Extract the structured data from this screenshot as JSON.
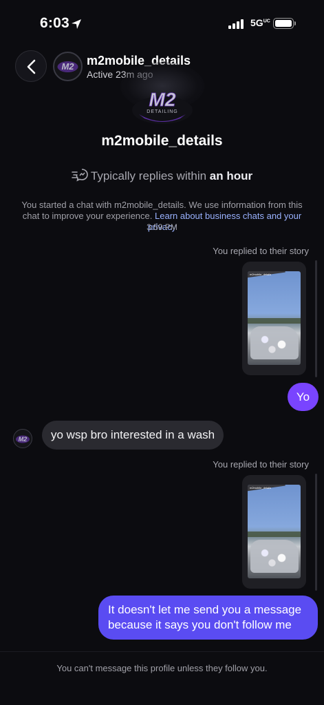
{
  "status_bar": {
    "time": "6:03",
    "network": "5G",
    "network_suffix": "UC"
  },
  "header": {
    "username": "m2mobile_details",
    "activity": "Active 23m ago",
    "icons": [
      "back-chevron-icon",
      "location-arrow-icon",
      "signal-bars-icon",
      "battery-icon"
    ]
  },
  "profile": {
    "name": "m2mobile_details",
    "logo_text_main": "M2",
    "logo_text_sub": "DETAILING",
    "replies_prefix": "Typically replies within ",
    "replies_bold": "an hour",
    "info_text": "You started a chat with m2mobile_details. We use information from this chat to improve your experience. ",
    "info_link": "Learn about business chats and your privacy",
    "timestamp": "3:59 PM"
  },
  "messages": [
    {
      "type": "story_reply",
      "label": "You replied to their story",
      "story_caption": "m2mobile_details"
    },
    {
      "type": "outgoing",
      "text": "Yo"
    },
    {
      "type": "incoming",
      "text": "yo wsp bro interested in a wash"
    },
    {
      "type": "story_reply",
      "label": "You replied to their story",
      "story_caption": "m2mobile_details"
    },
    {
      "type": "outgoing",
      "text": "It doesn't let me send you a message because it says you don't follow me"
    }
  ],
  "footer": {
    "text": "You can't message this profile unless they follow you."
  },
  "colors": {
    "accent_purple": "#7944ff",
    "accent_blue": "#5a4cf2",
    "link": "#9ab2ff",
    "background": "#0c0c10"
  }
}
